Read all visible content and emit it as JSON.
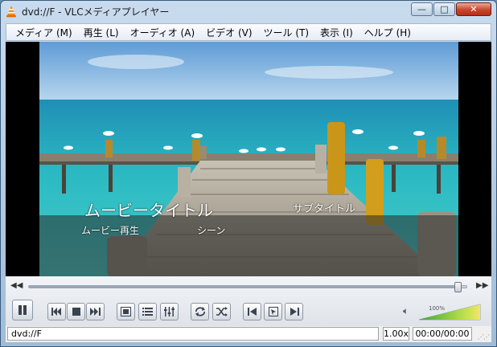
{
  "window": {
    "title": "dvd://F - VLCメディアプレイヤー",
    "buttons": {
      "minimize": "—",
      "maximize": "□",
      "close": "✕"
    }
  },
  "menu": [
    "メディア (M)",
    "再生 (L)",
    "オーディオ (A)",
    "ビデオ (V)",
    "ツール (T)",
    "表示 (I)",
    "ヘルプ (H)"
  ],
  "video": {
    "movie_title": "ムービータイトル",
    "subtitle": "サブタイトル",
    "menu_play": "ムービー再生",
    "menu_scenes": "シーン"
  },
  "controls": {
    "seek_position": 0.98,
    "volume_label": "100%",
    "volume_level": 1.0,
    "icons": [
      "pause-icon",
      "previous-chapter-icon",
      "stop-icon",
      "next-chapter-icon",
      "fullscreen-icon",
      "playlist-icon",
      "equalizer-icon",
      "loop-icon",
      "shuffle-icon",
      "frame-back-icon",
      "frame-icon",
      "frame-forward-icon",
      "volume-icon"
    ]
  },
  "status": {
    "path": "dvd://F",
    "speed": "1.00x",
    "time": "00:00/00:00"
  },
  "colors": {
    "titlebar_top": "#c9dbee",
    "close_button": "#c8452c",
    "sea": "#2bb8c2",
    "sky": "#7fb2df",
    "volume_green": "#3aa832"
  }
}
